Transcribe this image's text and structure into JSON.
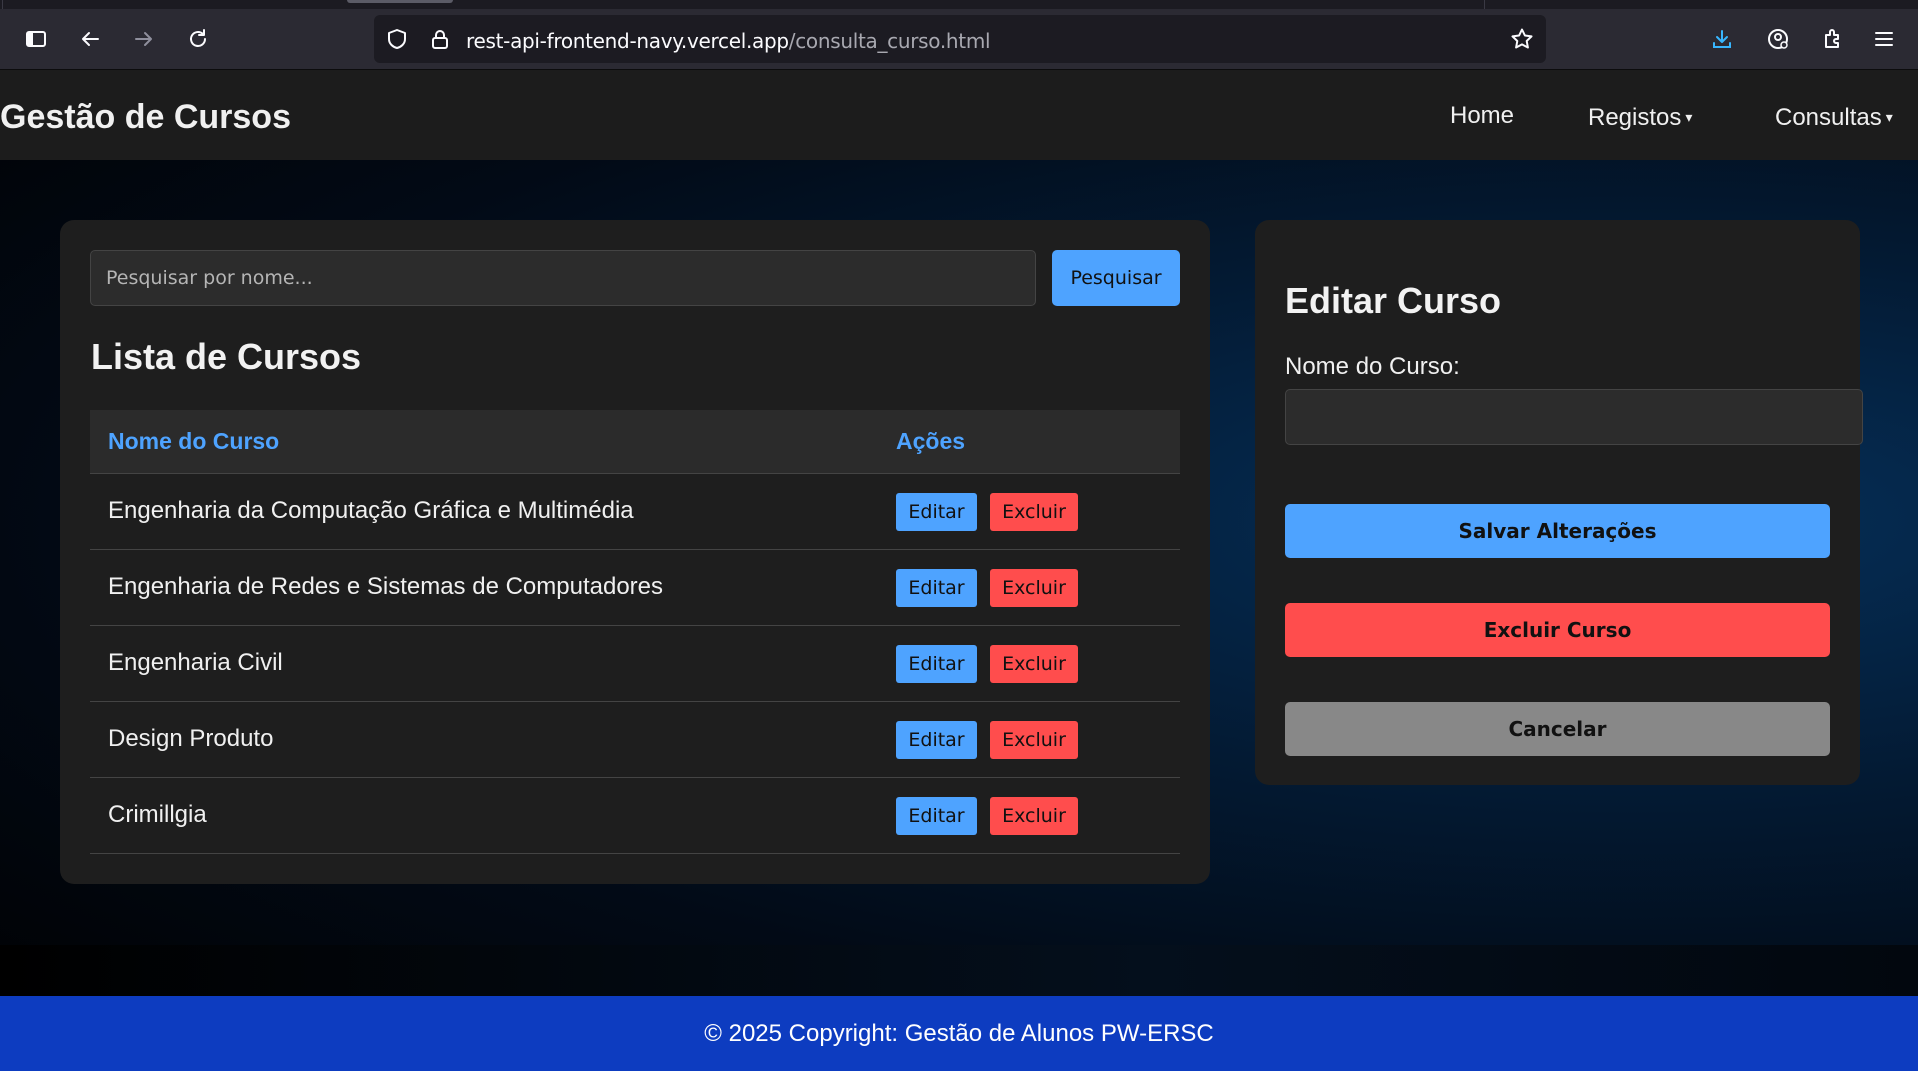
{
  "browser": {
    "url_host": "rest-api-frontend-navy.vercel.app",
    "url_path": "/consulta_curso.html",
    "icons": [
      "sidebar-icon",
      "back-icon",
      "forward-icon",
      "reload-icon",
      "shield-icon",
      "lock-icon",
      "star-icon",
      "download-icon",
      "account-icon",
      "extensions-icon",
      "menu-icon"
    ]
  },
  "navbar": {
    "brand": "Gestão de Cursos",
    "items": [
      {
        "label": "Home",
        "caret": ""
      },
      {
        "label": "Registos",
        "caret": "▾"
      },
      {
        "label": "Consultas",
        "caret": "▾"
      }
    ]
  },
  "search": {
    "placeholder": "Pesquisar por nome...",
    "button": "Pesquisar"
  },
  "list": {
    "title": "Lista de Cursos",
    "headers": [
      "Nome do Curso",
      "Ações"
    ],
    "rows": [
      {
        "name": "Engenharia da Computação Gráfica e Multimédia",
        "edit": "Editar",
        "delete": "Excluir"
      },
      {
        "name": "Engenharia de Redes e Sistemas de Computadores",
        "edit": "Editar",
        "delete": "Excluir"
      },
      {
        "name": "Engenharia Civil",
        "edit": "Editar",
        "delete": "Excluir"
      },
      {
        "name": "Design Produto",
        "edit": "Editar",
        "delete": "Excluir"
      },
      {
        "name": "Crimillgia",
        "edit": "Editar",
        "delete": "Excluir"
      }
    ]
  },
  "edit_panel": {
    "title": "Editar Curso",
    "field_label": "Nome do Curso:",
    "field_value": "",
    "save": "Salvar Alterações",
    "delete": "Excluir Curso",
    "cancel": "Cancelar"
  },
  "footer": {
    "text": "© 2025 Copyright: Gestão de Alunos PW-ERSC"
  },
  "colors": {
    "accent_blue": "#4ea3ff",
    "danger_red": "#ff4d4d",
    "neutral_gray": "#888888",
    "footer_blue": "#0d3cc0"
  }
}
